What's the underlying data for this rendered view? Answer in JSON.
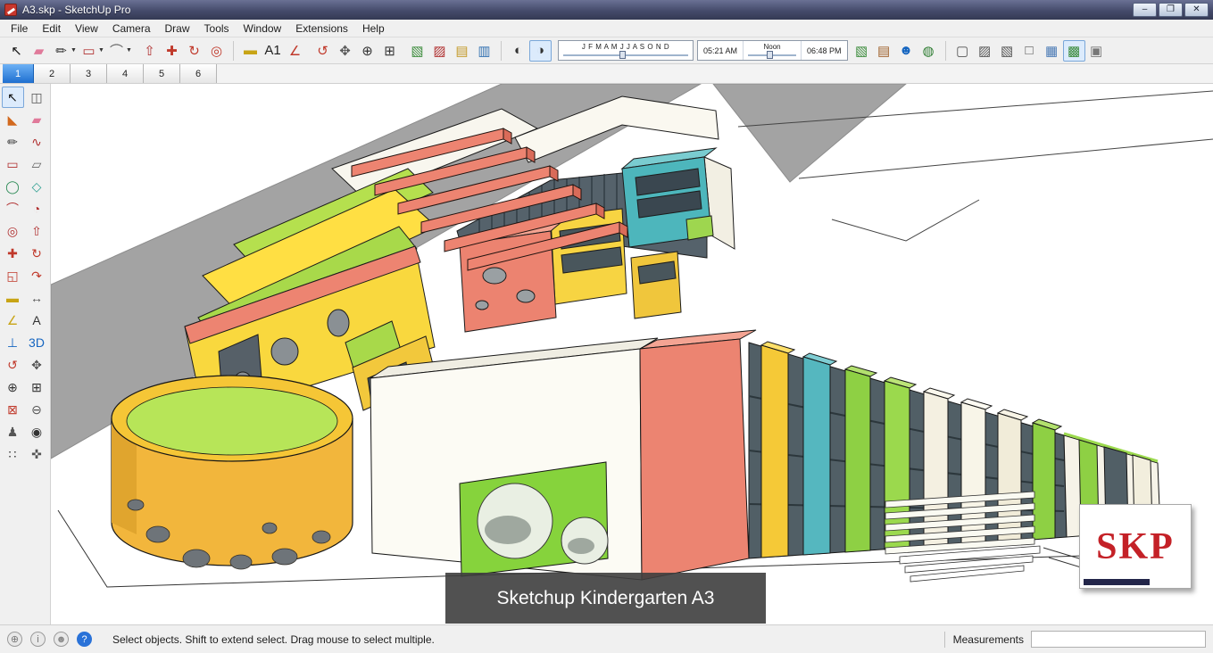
{
  "window": {
    "title": "A3.skp - SketchUp Pro",
    "controls": [
      {
        "name": "minimize-button",
        "label": "–",
        "color": "#1b2233"
      },
      {
        "name": "maximize-button",
        "label": "❐",
        "color": "#1b2233"
      },
      {
        "name": "close-button",
        "label": "✕",
        "color": "#1b2233"
      }
    ]
  },
  "menu": {
    "items": [
      {
        "name": "menu-file",
        "label": "File"
      },
      {
        "name": "menu-edit",
        "label": "Edit"
      },
      {
        "name": "menu-view",
        "label": "View"
      },
      {
        "name": "menu-camera",
        "label": "Camera"
      },
      {
        "name": "menu-draw",
        "label": "Draw"
      },
      {
        "name": "menu-tools",
        "label": "Tools"
      },
      {
        "name": "menu-window",
        "label": "Window"
      },
      {
        "name": "menu-extensions",
        "label": "Extensions"
      },
      {
        "name": "menu-help",
        "label": "Help"
      }
    ]
  },
  "toolbar": {
    "shadow_months": "J F M A M J J A S O N D",
    "time_start": "05:21 AM",
    "time_noon": "Noon",
    "time_end": "06:48 PM",
    "g1": [
      {
        "name": "select-icon",
        "label": "↖",
        "color": "#111111"
      },
      {
        "name": "eraser-icon",
        "label": "▰",
        "color": "#e07a9a"
      },
      {
        "name": "line-icon",
        "label": "✏",
        "color": "#333333"
      },
      {
        "name": "line-dropdown-icon",
        "label": "▼",
        "cls": "ddbtn"
      },
      {
        "name": "shape-icon",
        "label": "▭",
        "color": "#b03030"
      },
      {
        "name": "shape-dropdown-icon",
        "label": "▼",
        "cls": "ddbtn"
      },
      {
        "name": "arc-icon",
        "label": "⌒",
        "color": "#666666"
      },
      {
        "name": "arc-dropdown-icon",
        "label": "▼",
        "cls": "ddbtn"
      }
    ],
    "g2": [
      {
        "name": "push-pull-icon",
        "label": "⇧",
        "color": "#b03030"
      },
      {
        "name": "move-icon",
        "label": "✚",
        "color": "#c0392b"
      },
      {
        "name": "rotate-icon",
        "label": "↻",
        "color": "#c0392b"
      },
      {
        "name": "offset-icon",
        "label": "◎",
        "color": "#c0392b"
      }
    ],
    "g3": [
      {
        "name": "tape-measure-icon",
        "label": "▬",
        "color": "#c8a415"
      },
      {
        "name": "text-icon",
        "label": "A1",
        "color": "#222222"
      },
      {
        "name": "protractor-icon",
        "label": "∠",
        "color": "#c0392b"
      }
    ],
    "g4": [
      {
        "name": "orbit-icon",
        "label": "↺",
        "color": "#c0392b"
      },
      {
        "name": "pan-icon",
        "label": "✥",
        "color": "#555555"
      },
      {
        "name": "zoom-icon",
        "label": "⊕",
        "color": "#333333"
      },
      {
        "name": "zoom-window-icon",
        "label": "⊞",
        "color": "#333333"
      }
    ],
    "g5": [
      {
        "name": "get-current-view-icon",
        "label": "▧",
        "color": "#3c8c3c"
      },
      {
        "name": "photo-match-icon",
        "label": "▨",
        "color": "#b03030"
      },
      {
        "name": "texture-projection-icon",
        "label": "▤",
        "color": "#c49a2a"
      },
      {
        "name": "model-info-icon",
        "label": "▥",
        "color": "#2f6fb0"
      }
    ],
    "g6": [
      {
        "name": "shadow-settings-icon",
        "label": "◐",
        "color": "#333333"
      },
      {
        "name": "toggle-shadows-icon",
        "label": "◑",
        "color": "#333333",
        "pressed": true
      }
    ],
    "g7": [
      {
        "name": "add-building-icon",
        "label": "▧",
        "color": "#3c8c3c"
      },
      {
        "name": "add-terrain-icon",
        "label": "▤",
        "color": "#a0622d"
      },
      {
        "name": "add-person-icon",
        "label": "☻",
        "color": "#1565c0"
      },
      {
        "name": "add-location-icon",
        "label": "◍",
        "color": "#2e7d32"
      }
    ],
    "g8": [
      {
        "name": "x-ray-icon",
        "label": "▢",
        "color": "#555555"
      },
      {
        "name": "back-edges-icon",
        "label": "▨",
        "color": "#555555"
      },
      {
        "name": "wireframe-icon",
        "label": "▧",
        "color": "#555555"
      },
      {
        "name": "hidden-line-icon",
        "label": "□",
        "color": "#555555"
      },
      {
        "name": "shaded-icon",
        "label": "▦",
        "color": "#4a7ab5"
      },
      {
        "name": "shaded-textures-icon",
        "label": "▩",
        "color": "#3c8c3c",
        "pressed": true
      },
      {
        "name": "monochrome-icon",
        "label": "▣",
        "color": "#777777"
      }
    ]
  },
  "scene_tabs": {
    "items": [
      {
        "name": "scene-tab-1",
        "label": "1",
        "pressed": true
      },
      {
        "name": "scene-tab-2",
        "label": "2"
      },
      {
        "name": "scene-tab-3",
        "label": "3"
      },
      {
        "name": "scene-tab-4",
        "label": "4"
      },
      {
        "name": "scene-tab-5",
        "label": "5"
      },
      {
        "name": "scene-tab-6",
        "label": "6"
      }
    ]
  },
  "left_palette": {
    "icons": [
      {
        "name": "select-tool-icon",
        "label": "↖",
        "color": "#111111",
        "pressed": true
      },
      {
        "name": "make-component-icon",
        "label": "◫",
        "color": "#555555"
      },
      {
        "name": "paint-bucket-icon",
        "label": "◣",
        "color": "#d2691e"
      },
      {
        "name": "eraser-tool-icon",
        "label": "▰",
        "color": "#e07a9a"
      },
      {
        "name": "line-tool-icon",
        "label": "✏",
        "color": "#333333"
      },
      {
        "name": "freehand-tool-icon",
        "label": "∿",
        "color": "#b03030"
      },
      {
        "name": "rectangle-tool-icon",
        "label": "▭",
        "color": "#b03030"
      },
      {
        "name": "rotated-rectangle-icon",
        "label": "▱",
        "color": "#666666"
      },
      {
        "name": "circle-tool-icon",
        "label": "◯",
        "color": "#2e8b57"
      },
      {
        "name": "polygon-tool-icon",
        "label": "◇",
        "color": "#2a9d8f"
      },
      {
        "name": "arc-tool-icon",
        "label": "⌒",
        "color": "#b03030"
      },
      {
        "name": "pie-tool-icon",
        "label": "◔",
        "color": "#b03030"
      },
      {
        "name": "offset-tool-icon",
        "label": "◎",
        "color": "#b03030"
      },
      {
        "name": "push-pull-tool-icon",
        "label": "⇧",
        "color": "#b03030"
      },
      {
        "name": "move-tool-icon",
        "label": "✚",
        "color": "#c0392b"
      },
      {
        "name": "rotate-tool-icon",
        "label": "↻",
        "color": "#c0392b"
      },
      {
        "name": "scale-tool-icon",
        "label": "◱",
        "color": "#c0392b"
      },
      {
        "name": "follow-me-tool-icon",
        "label": "↷",
        "color": "#c0392b"
      },
      {
        "name": "tape-measure-tool-icon",
        "label": "▬",
        "color": "#c8a415"
      },
      {
        "name": "dimension-tool-icon",
        "label": "↔",
        "color": "#555555"
      },
      {
        "name": "protractor-tool-icon",
        "label": "∠",
        "color": "#c8a415"
      },
      {
        "name": "text-tool-icon",
        "label": "A",
        "color": "#333333"
      },
      {
        "name": "axes-tool-icon",
        "label": "⊥",
        "color": "#1565c0"
      },
      {
        "name": "3d-text-tool-icon",
        "label": "3D",
        "color": "#1565c0"
      },
      {
        "name": "orbit-tool-icon",
        "label": "↺",
        "color": "#c0392b"
      },
      {
        "name": "pan-tool-icon",
        "label": "✥",
        "color": "#555555"
      },
      {
        "name": "zoom-tool-icon",
        "label": "⊕",
        "color": "#333333"
      },
      {
        "name": "zoom-window-tool-icon",
        "label": "⊞",
        "color": "#333333"
      },
      {
        "name": "zoom-extents-tool-icon",
        "label": "⊠",
        "color": "#c0392b"
      },
      {
        "name": "zoom-previous-tool-icon",
        "label": "⊖",
        "color": "#555555"
      },
      {
        "name": "position-camera-tool-icon",
        "label": "♟",
        "color": "#555555"
      },
      {
        "name": "look-around-tool-icon",
        "label": "◉",
        "color": "#333333"
      },
      {
        "name": "walk-tool-icon",
        "label": "∷",
        "color": "#333333"
      },
      {
        "name": "section-plane-tool-icon",
        "label": "✜",
        "color": "#555555"
      }
    ]
  },
  "viewport": {
    "caption": "Sketchup Kindergarten A3",
    "logo_text": "SKP"
  },
  "status_bar": {
    "icons": [
      {
        "name": "geo-location-icon",
        "label": "⊕",
        "color": "#777777"
      },
      {
        "name": "credits-icon",
        "label": "i",
        "color": "#777777"
      },
      {
        "name": "user-icon",
        "label": "☻",
        "color": "#888888"
      },
      {
        "name": "help-icon",
        "label": "?",
        "color": "#ffffff",
        "bg": "#2a72d8"
      }
    ],
    "message": "Select objects. Shift to extend select. Drag mouse to select multiple.",
    "measurements_label": "Measurements",
    "measurements_value": ""
  },
  "colors": {
    "titlebar": "#3f4460",
    "active_tab": "#1e6fd0",
    "logo_red": "#c42127",
    "building_salmon": "#ec8471",
    "building_yellow": "#f7d442",
    "building_green": "#8ed044",
    "building_teal": "#55b7bf",
    "road_gray": "#a3a3a3"
  }
}
